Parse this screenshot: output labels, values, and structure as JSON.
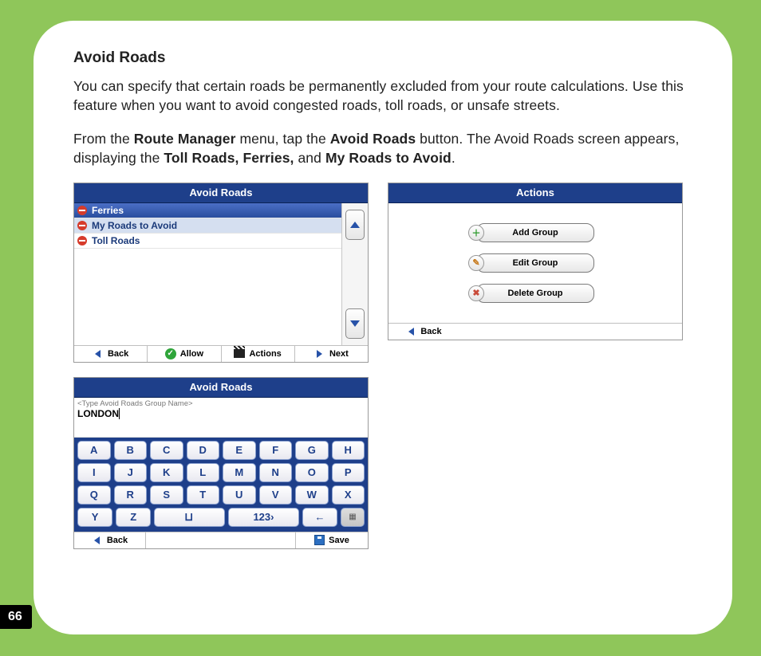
{
  "page_number": "66",
  "doc": {
    "title": "Avoid Roads",
    "para1": "You can specify that certain roads be permanently excluded from your route calculations.  Use this feature when you want to avoid congested roads, toll roads, or unsafe streets.",
    "para2_a": "From the ",
    "para2_b1": "Route Manager",
    "para2_c": " menu, tap the ",
    "para2_b2": "Avoid Roads",
    "para2_d": " button. The Avoid Roads screen appears, displaying the ",
    "para2_b3": "Toll Roads, Ferries,",
    "para2_e": " and ",
    "para2_b4": "My Roads to Avoid",
    "para2_f": "."
  },
  "screenshot1": {
    "title": "Avoid Roads",
    "items": [
      "Ferries",
      "My Roads to Avoid",
      "Toll Roads"
    ],
    "footer": {
      "back": "Back",
      "allow": "Allow",
      "actions": "Actions",
      "next": "Next"
    }
  },
  "screenshot2": {
    "title": "Actions",
    "buttons": {
      "add": "Add Group",
      "edit": "Edit Group",
      "del": "Delete Group"
    },
    "footer": {
      "back": "Back"
    }
  },
  "screenshot3": {
    "title": "Avoid Roads",
    "hint": "<Type Avoid Roads Group Name>",
    "typed": "LONDON",
    "keys_r1": [
      "A",
      "B",
      "C",
      "D",
      "E",
      "F",
      "G",
      "H"
    ],
    "keys_r2": [
      "I",
      "J",
      "K",
      "L",
      "M",
      "N",
      "O",
      "P"
    ],
    "keys_r3": [
      "Q",
      "R",
      "S",
      "T",
      "U",
      "V",
      "W",
      "X"
    ],
    "keys_r4": {
      "y": "Y",
      "z": "Z",
      "space": "⊔",
      "num": "123›",
      "back": "←"
    },
    "footer": {
      "back": "Back",
      "save": "Save"
    }
  }
}
